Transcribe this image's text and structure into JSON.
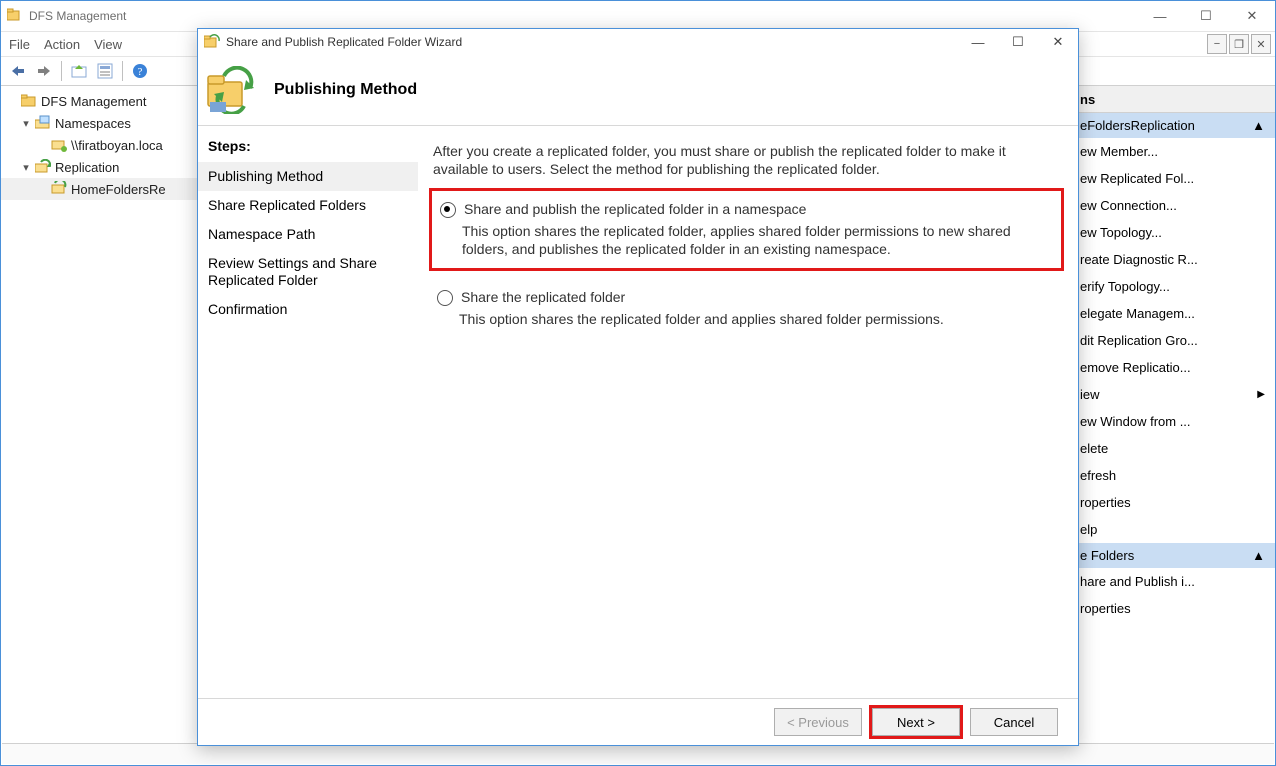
{
  "main_window": {
    "title": "DFS Management",
    "menu": {
      "file": "File",
      "action": "Action",
      "view": "View"
    },
    "tree": {
      "root": "DFS Management",
      "namespaces": "Namespaces",
      "namespace_path": "\\\\firatboyan.loca",
      "replication": "Replication",
      "replication_item": "HomeFoldersRe"
    },
    "actions_header": "ns",
    "actions": {
      "group_top": "eFoldersReplication",
      "items": [
        "ew Member...",
        "ew Replicated Fol...",
        "ew Connection...",
        "ew Topology...",
        "reate Diagnostic R...",
        "erify Topology...",
        "elegate Managem...",
        "dit Replication Gro...",
        "emove Replicatio...",
        "iew",
        "ew Window from ...",
        "elete",
        "efresh",
        "roperties",
        "elp"
      ],
      "group_mid": "e Folders",
      "items2": [
        "hare and Publish i...",
        "roperties"
      ]
    }
  },
  "wizard": {
    "title": "Share and Publish Replicated Folder Wizard",
    "header": "Publishing Method",
    "steps_label": "Steps:",
    "steps": [
      "Publishing Method",
      "Share Replicated Folders",
      "Namespace Path",
      "Review Settings and Share Replicated Folder",
      "Confirmation"
    ],
    "intro": "After you create a replicated folder, you must share or publish the replicated folder to make it available to users. Select the method for publishing the replicated folder.",
    "option1_label": "Share and publish the replicated folder in a namespace",
    "option1_desc": "This option shares the replicated folder, applies shared folder permissions to new shared folders, and publishes the replicated folder in an existing namespace.",
    "option2_label": "Share the replicated folder",
    "option2_desc": "This option shares the replicated folder and applies shared folder permissions.",
    "buttons": {
      "prev": "< Previous",
      "next": "Next >",
      "cancel": "Cancel"
    }
  }
}
